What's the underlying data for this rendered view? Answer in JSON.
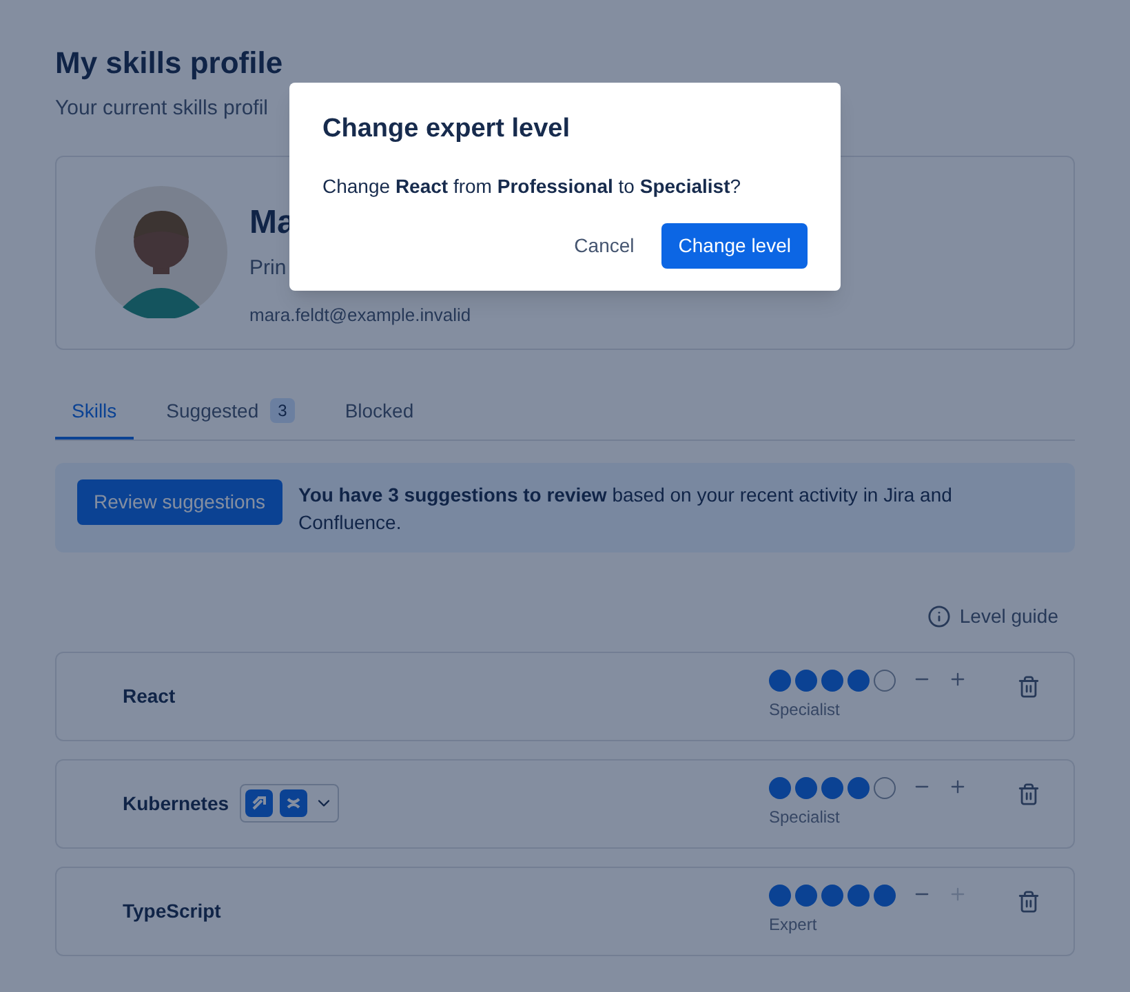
{
  "page": {
    "title": "My skills profile",
    "subtitle": "Your current skills profil"
  },
  "profile": {
    "name": "Ma",
    "role": "Prin",
    "email": "mara.feldt@example.invalid"
  },
  "tabs": [
    {
      "label": "Skills",
      "selected": true
    },
    {
      "label": "Suggested",
      "selected": false,
      "badge": "3"
    },
    {
      "label": "Blocked",
      "selected": false
    }
  ],
  "banner": {
    "button": "Review suggestions",
    "text": "**You have 3 suggestions to review** based on your recent activity in Jira and Confluence."
  },
  "level_guide": "Level guide",
  "skills": [
    {
      "name": "React",
      "stars": 4,
      "level_label": "Specialist",
      "has_sources": false,
      "can_decrease": true,
      "can_increase": true
    },
    {
      "name": "Kubernetes",
      "stars": 4,
      "level_label": "Specialist",
      "has_sources": true,
      "can_decrease": true,
      "can_increase": true
    },
    {
      "name": "TypeScript",
      "stars": 5,
      "level_label": "Expert",
      "has_sources": false,
      "can_decrease": true,
      "can_increase": false
    }
  ],
  "dialog": {
    "title": "Change expert level",
    "message": "Change **React** from **Professional** to **Specialist**?",
    "cancel": "Cancel",
    "confirm": "Change level"
  }
}
